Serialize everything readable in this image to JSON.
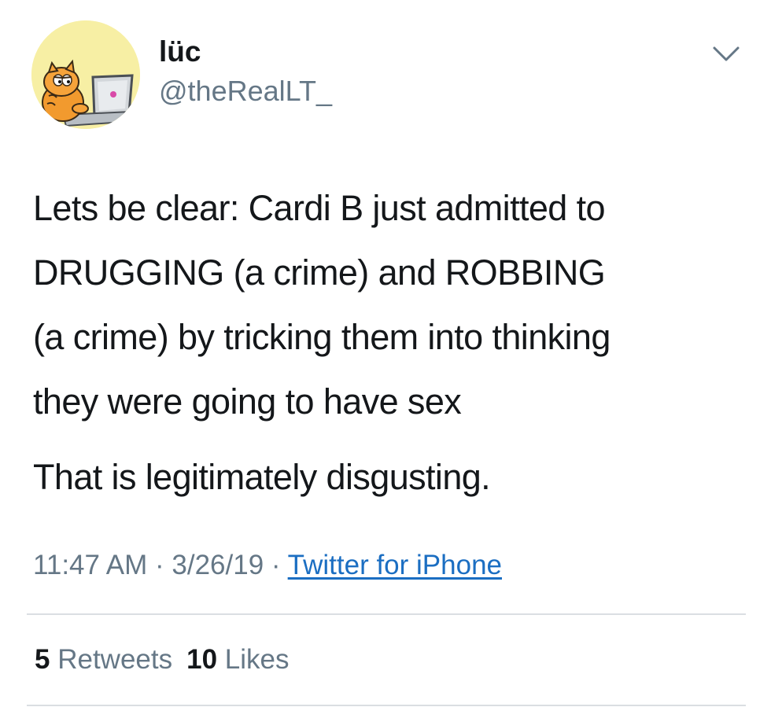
{
  "user": {
    "display_name": "lüc",
    "handle": "@theRealLT_",
    "avatar_icon": "garfield-at-computer-avatar"
  },
  "menu": {
    "icon": "chevron-down-icon"
  },
  "tweet": {
    "lines": [
      "Lets be clear: Cardi B just admitted to",
      "DRUGGING (a crime) and ROBBING",
      "(a crime) by tricking them into thinking",
      "they were going to have sex",
      "That is legitimately disgusting."
    ]
  },
  "meta": {
    "time": "11:47 AM",
    "separator": " · ",
    "date": "3/26/19",
    "source": "Twitter for iPhone"
  },
  "stats": {
    "retweets_count": "5",
    "retweets_label": "Retweets",
    "likes_count": "10",
    "likes_label": "Likes"
  },
  "colors": {
    "text": "#14171a",
    "secondary": "#657786",
    "link": "#1b6ec2",
    "divider": "#dadee2",
    "avatar_bg": "#f7efa4"
  }
}
